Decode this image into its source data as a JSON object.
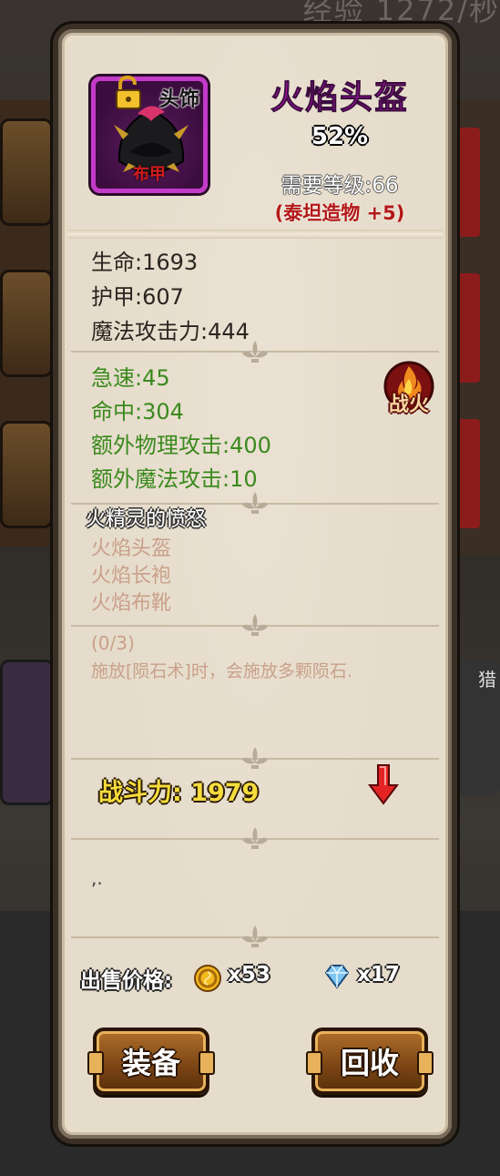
{
  "background": {
    "title_fragment": "经验 1272/秒",
    "right_label": "猎"
  },
  "item": {
    "slot": "头饰",
    "material": "布甲",
    "name": "火焰头盔",
    "quality": "52%",
    "required_level": "需要等级:66",
    "titan_bonus": "(泰坦造物 +5)"
  },
  "base_stats": [
    "生命:1693",
    "护甲:607",
    "魔法攻击力:444"
  ],
  "bonus_stats": [
    "急速:45",
    "命中:304",
    "额外物理攻击:400",
    "额外魔法攻击:10"
  ],
  "badge": {
    "label": "战火",
    "icon": "warfire-flame-icon"
  },
  "set": {
    "title": "火精灵的愤怒",
    "items": [
      "火焰头盔",
      "火焰长袍",
      "火焰布靴"
    ],
    "progress": "(0/3)",
    "bonus": "施放[陨石术]时，会施放多颗陨石."
  },
  "power": {
    "label": "战斗力: 1979",
    "trend_icon": "red-down-arrow-icon"
  },
  "description": ",.",
  "price": {
    "label": "出售价格:",
    "coin_value": "x53",
    "gem_value": "x17"
  },
  "buttons": {
    "equip": "装备",
    "recycle": "回收"
  },
  "colors": {
    "item_name": "#d21ad8",
    "bonus_stat": "#3b8a1e",
    "titan": "#b31818",
    "power": "#f6dc3c",
    "frame": "#c33ac9"
  }
}
